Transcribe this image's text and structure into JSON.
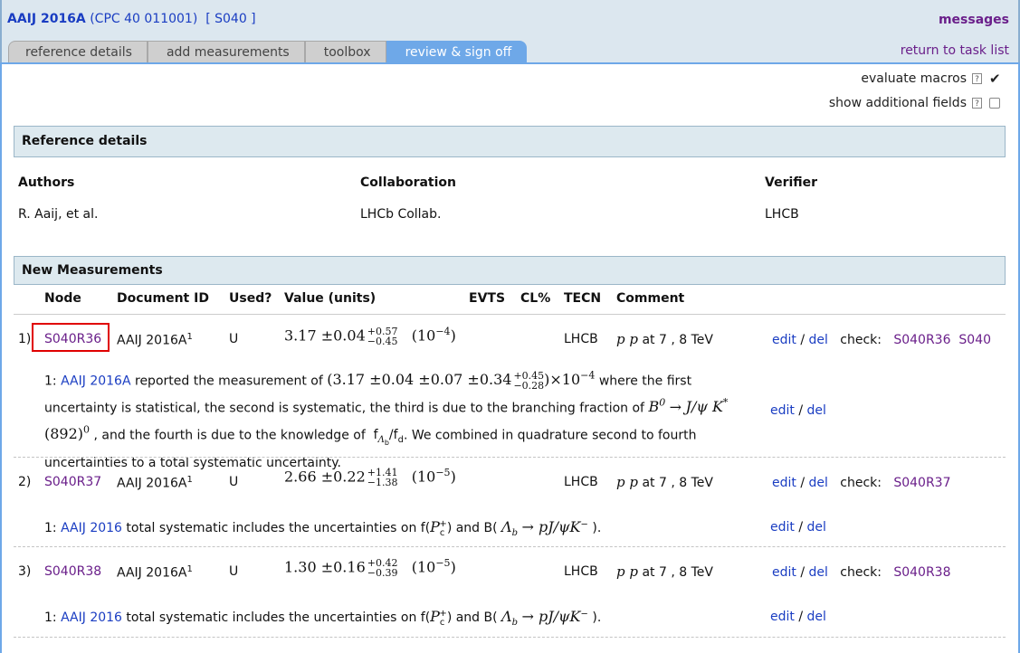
{
  "header": {
    "ref_code": "AAIJ 2016A",
    "ref_journal": "(CPC 40 011001)",
    "ref_node": "[ S040 ]",
    "messages": "messages",
    "return_link": "return to task list"
  },
  "tabs": [
    "reference details",
    "add measurements",
    "toolbox",
    "review & sign off"
  ],
  "options": {
    "evaluate_macros": {
      "label": "evaluate macros",
      "help": "?",
      "checked": true
    },
    "show_additional": {
      "label": "show additional fields",
      "help": "?",
      "checked": false
    }
  },
  "reference": {
    "heading": "Reference details",
    "authors_label": "Authors",
    "authors": "R. Aaij, et al.",
    "collab_label": "Collaboration",
    "collab": "LHCb Collab.",
    "verifier_label": "Verifier",
    "verifier": "LHCB"
  },
  "measurements": {
    "heading": "New Measurements",
    "columns": {
      "node": "Node",
      "docid": "Document ID",
      "used": "Used?",
      "value": "Value (units)",
      "evts": "EVTS",
      "cl": "CL%",
      "tecn": "TECN",
      "comment": "Comment"
    },
    "rows": [
      {
        "index": "1)",
        "node": "S040R36",
        "docid": "AAIJ 2016A",
        "docsup": "1",
        "used": "U",
        "value": "3.17 ±0.04",
        "up": "+0.57",
        "down": "−0.45",
        "units": "(10",
        "exp": "−4",
        "units_close": ")",
        "tecn": "LHCB",
        "comment_pp": "p p",
        "comment_rest": "at 7 , 8 TeV",
        "edit": "edit",
        "del": "del",
        "check_label": "check:",
        "checks": [
          "S040R36",
          "S040"
        ],
        "note": {
          "num": "1:",
          "ref": "AAIJ 2016A",
          "t1": "reported the measurement of",
          "m1": "(3.17 ±0.04 ±0.07 ±0.34",
          "m1_up": "+0.45",
          "m1_down": "−0.28",
          "m1_tail": ")×10",
          "m1_exp": "−4",
          "t2": "where the   first uncertainty is statistical, the second is systematic, the third is due to the branching   fraction of",
          "m2": "B",
          "m2_sup": "0",
          "m2_arrow": "→",
          "m3": "J/ψ K",
          "m3_sup": "*",
          "m3_tail": "(892)",
          "m3_exp": "0",
          "t3": ", and the fourth is due to the knowledge of",
          "f1": "f",
          "f1_sub": "Λ",
          "f1_subsub": "b",
          "f2": "/f",
          "f2_sub": "d",
          "t4": ". We combined in quadrature second to fourth uncertainties to a total   systematic uncertainty.",
          "edit": "edit",
          "del": "del"
        }
      },
      {
        "index": "2)",
        "node": "S040R37",
        "docid": "AAIJ 2016A",
        "docsup": "1",
        "used": "U",
        "value": "2.66 ±0.22",
        "up": "+1.41",
        "down": "−1.38",
        "units": "(10",
        "exp": "−5",
        "units_close": ")",
        "tecn": "LHCB",
        "comment_pp": "p p",
        "comment_rest": "at 7 , 8 TeV",
        "edit": "edit",
        "del": "del",
        "check_label": "check:",
        "checks": [
          "S040R37"
        ],
        "note": {
          "num": "1:",
          "ref": "AAIJ 2016",
          "t1": "total systematic includes the uncertainties on f(",
          "p": "P",
          "p_sup": "+",
          "p_sub": "c",
          "t2": ") and B(",
          "lam": "Λ",
          "lam_sub": "b",
          "arrow": "→ pJ/ψK",
          "arrow_sup": "−",
          "t3": ").",
          "edit": "edit",
          "del": "del"
        }
      },
      {
        "index": "3)",
        "node": "S040R38",
        "docid": "AAIJ 2016A",
        "docsup": "1",
        "used": "U",
        "value": "1.30 ±0.16",
        "up": "+0.42",
        "down": "−0.39",
        "units": "(10",
        "exp": "−5",
        "units_close": ")",
        "tecn": "LHCB",
        "comment_pp": "p p",
        "comment_rest": "at 7 , 8 TeV",
        "edit": "edit",
        "del": "del",
        "check_label": "check:",
        "checks": [
          "S040R38"
        ],
        "note": {
          "num": "1:",
          "ref": "AAIJ 2016",
          "t1": "total systematic includes the uncertainties on f(",
          "p": "P",
          "p_sup": "+",
          "p_sub": "c",
          "t2": ") and B(",
          "lam": "Λ",
          "lam_sub": "b",
          "arrow": "→ pJ/ψK",
          "arrow_sup": "−",
          "t3": ").",
          "edit": "edit",
          "del": "del"
        }
      }
    ]
  }
}
